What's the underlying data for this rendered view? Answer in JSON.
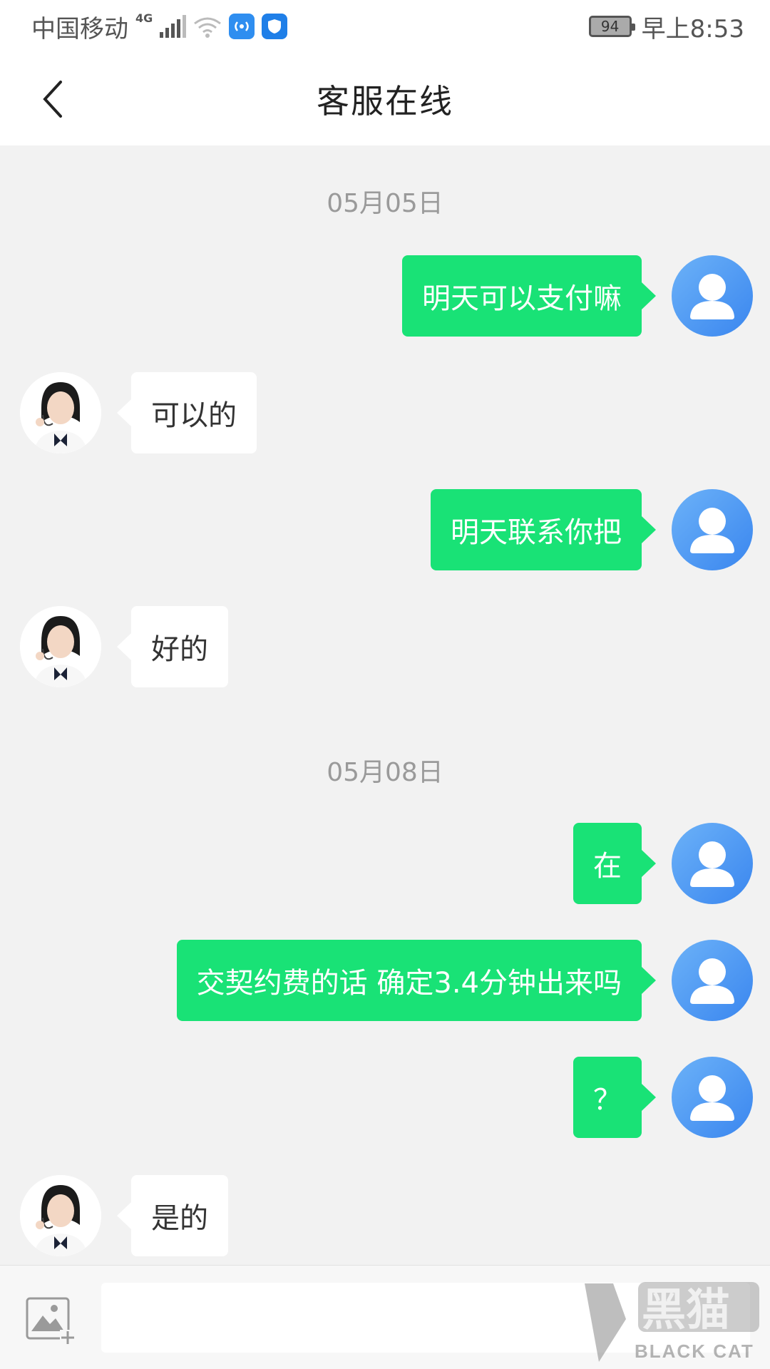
{
  "status_bar": {
    "carrier": "中国移动",
    "network": "4G",
    "battery": "94",
    "time": "早上8:53"
  },
  "header": {
    "title": "客服在线"
  },
  "chat": {
    "date_1": "05月05日",
    "date_2": "05月08日",
    "messages": [
      {
        "from": "user",
        "text": "明天可以支付嘛"
      },
      {
        "from": "agent",
        "text": "可以的"
      },
      {
        "from": "user",
        "text": "明天联系你把"
      },
      {
        "from": "agent",
        "text": "好的"
      },
      {
        "from": "user",
        "text": "在"
      },
      {
        "from": "user",
        "text": "交契约费的话 确定3.4分钟出来吗"
      },
      {
        "from": "user",
        "text": "？"
      },
      {
        "from": "agent",
        "text": "是的"
      }
    ]
  },
  "input": {
    "placeholder": "",
    "value": ""
  },
  "watermark": {
    "logo_text": "黑猫",
    "sub_text": "BLACK CAT"
  },
  "colors": {
    "outgoing_bubble": "#19e276",
    "user_avatar": "#4a95f2",
    "chat_background": "#f2f2f2"
  },
  "icons": {
    "back": "chevron-left-icon",
    "image_upload": "add-image-icon",
    "user_avatar": "user-silhouette-icon"
  }
}
